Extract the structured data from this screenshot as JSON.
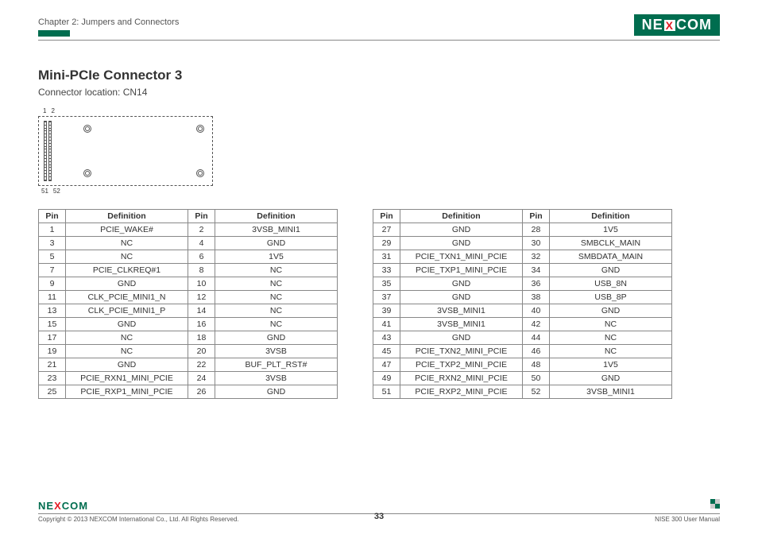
{
  "header": {
    "chapter": "Chapter 2: Jumpers and Connectors",
    "brand_pre": "NE",
    "brand_x": "X",
    "brand_post": "COM"
  },
  "section": {
    "title": "Mini-PCIe Connector 3",
    "subtitle": "Connector location: CN14"
  },
  "diagram_labels": {
    "tl1": "1",
    "tl2": "2",
    "bl1": "51",
    "bl2": "52"
  },
  "table_headers": {
    "pin": "Pin",
    "def": "Definition"
  },
  "table_left": [
    {
      "p1": "1",
      "d1": "PCIE_WAKE#",
      "p2": "2",
      "d2": "3VSB_MINI1"
    },
    {
      "p1": "3",
      "d1": "NC",
      "p2": "4",
      "d2": "GND"
    },
    {
      "p1": "5",
      "d1": "NC",
      "p2": "6",
      "d2": "1V5"
    },
    {
      "p1": "7",
      "d1": "PCIE_CLKREQ#1",
      "p2": "8",
      "d2": "NC"
    },
    {
      "p1": "9",
      "d1": "GND",
      "p2": "10",
      "d2": "NC"
    },
    {
      "p1": "11",
      "d1": "CLK_PCIE_MINI1_N",
      "p2": "12",
      "d2": "NC"
    },
    {
      "p1": "13",
      "d1": "CLK_PCIE_MINI1_P",
      "p2": "14",
      "d2": "NC"
    },
    {
      "p1": "15",
      "d1": "GND",
      "p2": "16",
      "d2": "NC"
    },
    {
      "p1": "17",
      "d1": "NC",
      "p2": "18",
      "d2": "GND"
    },
    {
      "p1": "19",
      "d1": "NC",
      "p2": "20",
      "d2": "3VSB"
    },
    {
      "p1": "21",
      "d1": "GND",
      "p2": "22",
      "d2": "BUF_PLT_RST#"
    },
    {
      "p1": "23",
      "d1": "PCIE_RXN1_MINI_PCIE",
      "p2": "24",
      "d2": "3VSB"
    },
    {
      "p1": "25",
      "d1": "PCIE_RXP1_MINI_PCIE",
      "p2": "26",
      "d2": "GND"
    }
  ],
  "table_right": [
    {
      "p1": "27",
      "d1": "GND",
      "p2": "28",
      "d2": "1V5"
    },
    {
      "p1": "29",
      "d1": "GND",
      "p2": "30",
      "d2": "SMBCLK_MAIN"
    },
    {
      "p1": "31",
      "d1": "PCIE_TXN1_MINI_PCIE",
      "p2": "32",
      "d2": "SMBDATA_MAIN"
    },
    {
      "p1": "33",
      "d1": "PCIE_TXP1_MINI_PCIE",
      "p2": "34",
      "d2": "GND"
    },
    {
      "p1": "35",
      "d1": "GND",
      "p2": "36",
      "d2": "USB_8N"
    },
    {
      "p1": "37",
      "d1": "GND",
      "p2": "38",
      "d2": "USB_8P"
    },
    {
      "p1": "39",
      "d1": "3VSB_MINI1",
      "p2": "40",
      "d2": "GND"
    },
    {
      "p1": "41",
      "d1": "3VSB_MINI1",
      "p2": "42",
      "d2": "NC"
    },
    {
      "p1": "43",
      "d1": "GND",
      "p2": "44",
      "d2": "NC"
    },
    {
      "p1": "45",
      "d1": "PCIE_TXN2_MINI_PCIE",
      "p2": "46",
      "d2": "NC"
    },
    {
      "p1": "47",
      "d1": "PCIE_TXP2_MINI_PCIE",
      "p2": "48",
      "d2": "1V5"
    },
    {
      "p1": "49",
      "d1": "PCIE_RXN2_MINI_PCIE",
      "p2": "50",
      "d2": "GND"
    },
    {
      "p1": "51",
      "d1": "PCIE_RXP2_MINI_PCIE",
      "p2": "52",
      "d2": "3VSB_MINI1"
    }
  ],
  "footer": {
    "copyright": "Copyright © 2013 NEXCOM International Co., Ltd. All Rights Reserved.",
    "page": "33",
    "doc": "NISE 300 User Manual",
    "brand_pre": "NE",
    "brand_x": "X",
    "brand_post": "COM"
  }
}
